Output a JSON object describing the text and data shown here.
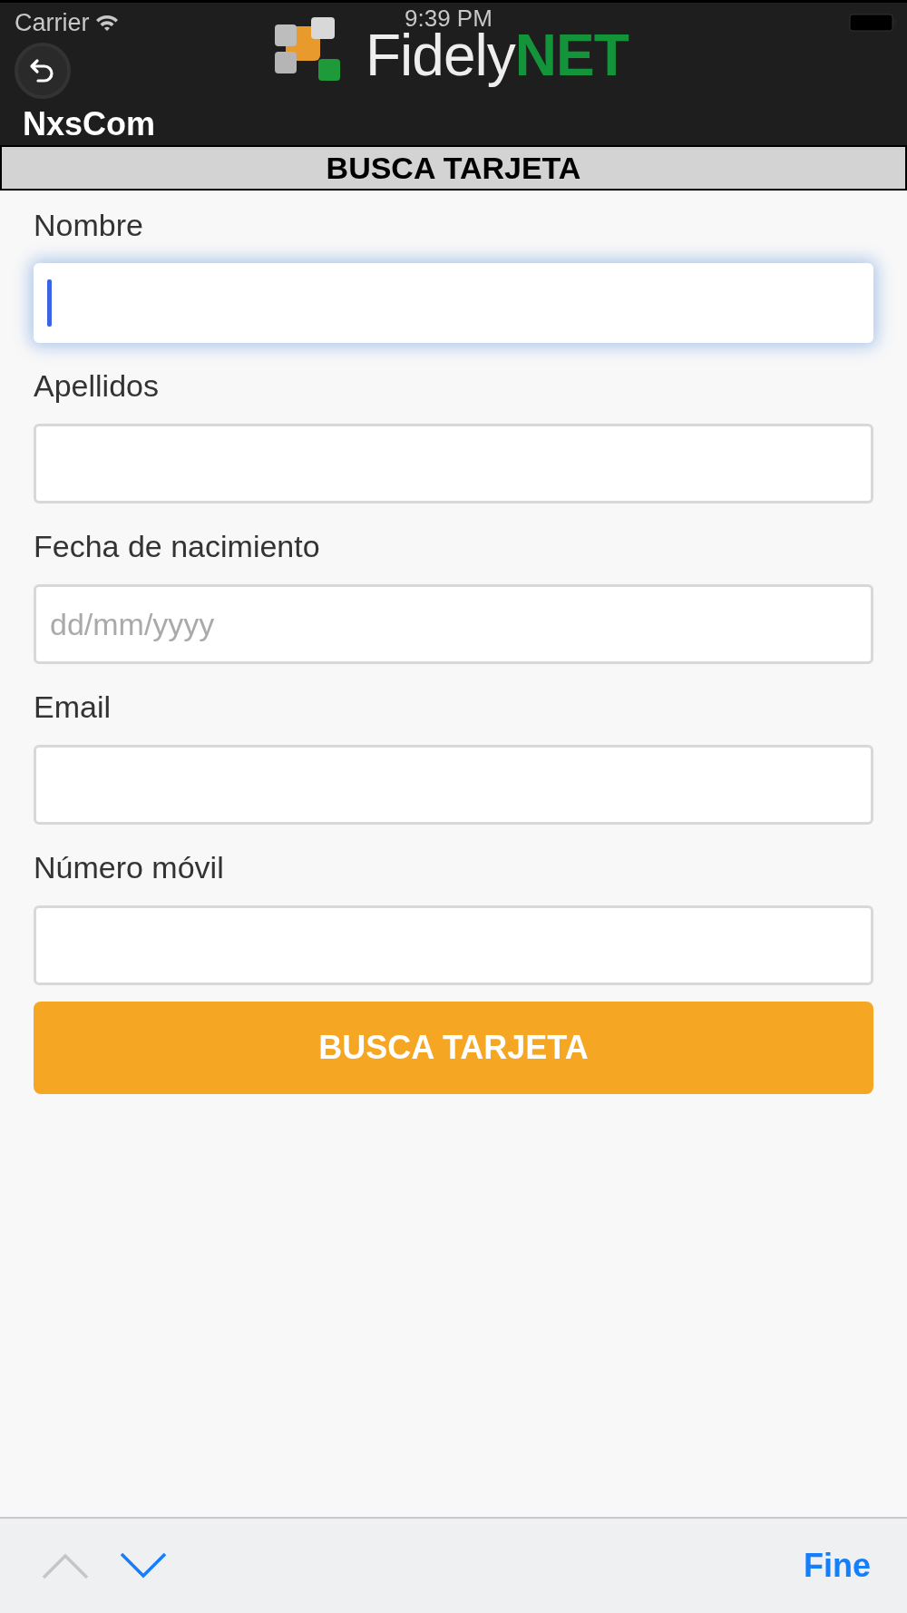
{
  "status_bar": {
    "carrier": "Carrier",
    "time": "9:39 PM"
  },
  "header": {
    "logo": {
      "part_1": "Fidely",
      "part_2": "NET"
    },
    "account": "NxsCom"
  },
  "page_title": "BUSCA TARJETA",
  "fields": [
    {
      "label": "Nombre",
      "focused": true
    },
    {
      "label": "Apellidos",
      "focused": false
    },
    {
      "label": "Fecha de nacimiento",
      "placeholder": "dd/mm/yyyy",
      "focused": false
    },
    {
      "label": "Email",
      "focused": false
    },
    {
      "label": "Número móvil",
      "focused": false
    }
  ],
  "submit_button": "BUSCA TARJETA",
  "keyboard_toolbar": {
    "previous": {
      "disabled": true
    },
    "next": {
      "disabled": false
    },
    "done": "Fine"
  }
}
